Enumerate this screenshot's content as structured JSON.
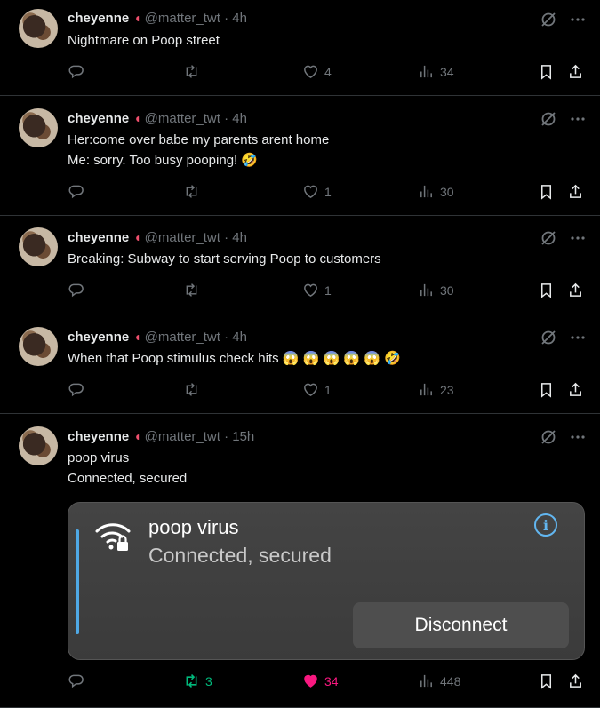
{
  "tweets": [
    {
      "name": "cheyenne",
      "handle": "@matter_twt · 4h",
      "lines": [
        "Nightmare on Poop street"
      ],
      "replies": "",
      "retweets": "",
      "likes": "4",
      "views": "34"
    },
    {
      "name": "cheyenne",
      "handle": "@matter_twt · 4h",
      "lines": [
        "Her:come over babe my parents arent home",
        "Me: sorry. Too busy pooping! 🤣"
      ],
      "replies": "",
      "retweets": "",
      "likes": "1",
      "views": "30"
    },
    {
      "name": "cheyenne",
      "handle": "@matter_twt · 4h",
      "lines": [
        "Breaking: Subway to start serving Poop to customers"
      ],
      "replies": "",
      "retweets": "",
      "likes": "1",
      "views": "30"
    },
    {
      "name": "cheyenne",
      "handle": "@matter_twt · 4h",
      "lines": [
        "When that Poop stimulus check hits 😱 😱 😱 😱 😱 🤣"
      ],
      "replies": "",
      "retweets": "",
      "likes": "1",
      "views": "23"
    },
    {
      "name": "cheyenne",
      "handle": "@matter_twt · 15h",
      "lines": [
        "poop virus",
        "Connected, secured"
      ],
      "replies": "",
      "retweets": "3",
      "likes": "34",
      "views": "448"
    }
  ],
  "card": {
    "title": "poop virus",
    "subtitle": "Connected, secured",
    "button": "Disconnect"
  },
  "icons": {
    "no_grok": "slash-circle-icon",
    "more": "more-icon",
    "reply": "reply-icon",
    "retweet": "retweet-icon",
    "like": "heart-icon",
    "views": "views-icon",
    "bookmark": "bookmark-icon",
    "share": "share-icon"
  },
  "colors": {
    "retweet_active": "#00ba7c",
    "like_active": "#f91880",
    "muted": "#71767b"
  }
}
